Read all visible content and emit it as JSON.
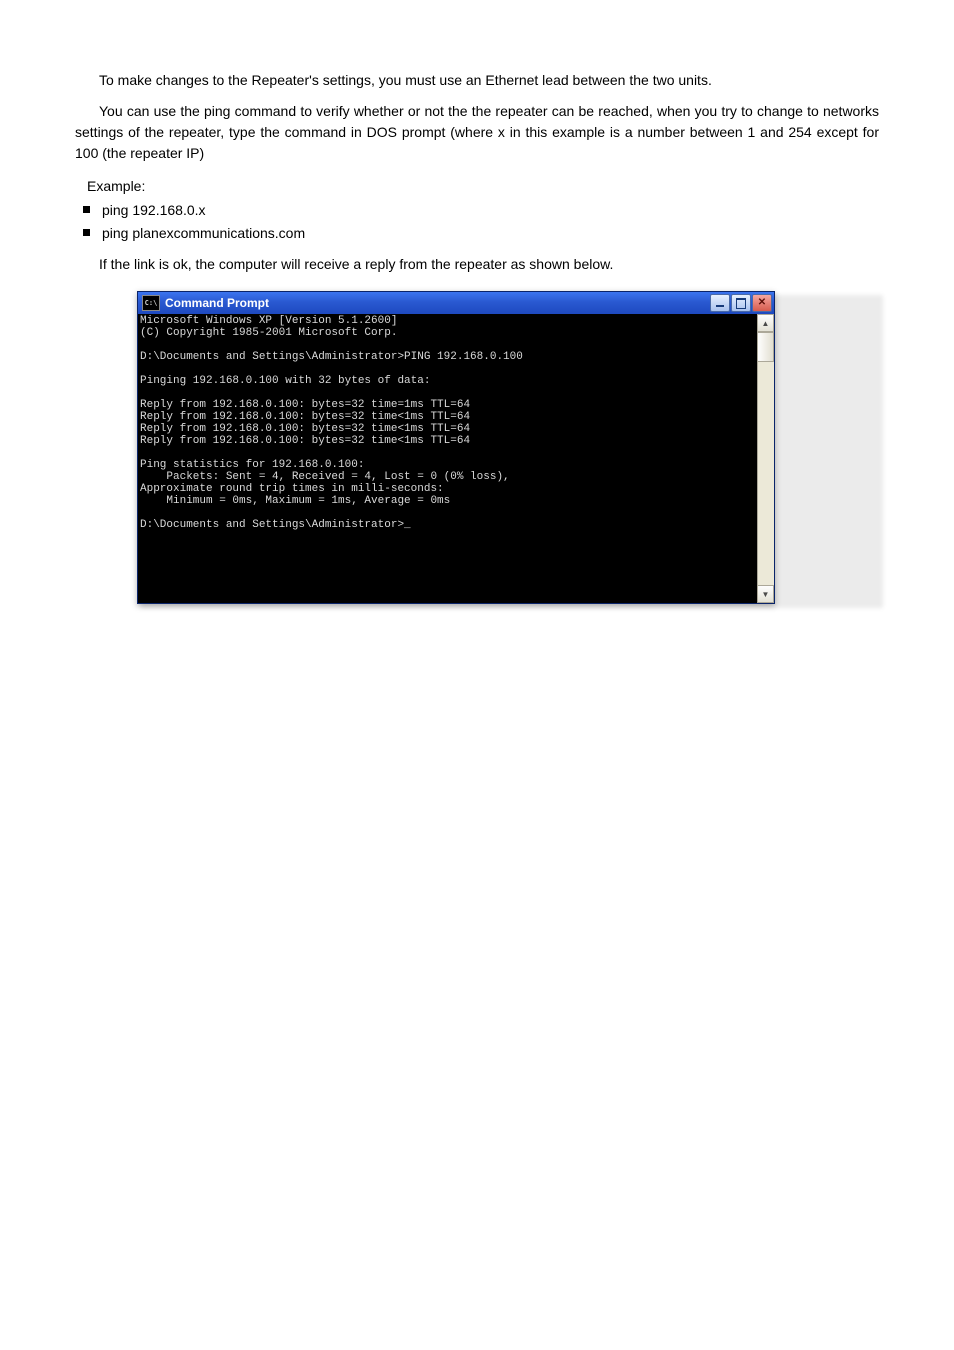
{
  "doc": {
    "para1_before": "To make changes to the Repeater",
    "para1_apostrophe": "'s",
    "para1_after": " settings, you must use an Ethernet lead between the two units.",
    "para2": "You can use the ping command to verify whether or not the the repeater can be reached, when you try to change to networks settings of the repeater, type the command in DOS prompt (where x in this example is a number between 1 and 254 except for 100 (the repeater IP)",
    "label": "Example:",
    "bullet1": "ping 192.168.0.x",
    "bullet2": "ping planexcommunications.com",
    "para3": "If the link is ok, the computer will receive a reply from the repeater as shown below."
  },
  "cmd": {
    "title": "Command Prompt",
    "icon_text": "C:\\",
    "lines": [
      "Microsoft Windows XP [Version 5.1.2600]",
      "(C) Copyright 1985-2001 Microsoft Corp.",
      "",
      "D:\\Documents and Settings\\Administrator>PING 192.168.0.100",
      "",
      "Pinging 192.168.0.100 with 32 bytes of data:",
      "",
      "Reply from 192.168.0.100: bytes=32 time=1ms TTL=64",
      "Reply from 192.168.0.100: bytes=32 time<1ms TTL=64",
      "Reply from 192.168.0.100: bytes=32 time<1ms TTL=64",
      "Reply from 192.168.0.100: bytes=32 time<1ms TTL=64",
      "",
      "Ping statistics for 192.168.0.100:",
      "    Packets: Sent = 4, Received = 4, Lost = 0 (0% loss),",
      "Approximate round trip times in milli-seconds:",
      "    Minimum = 0ms, Maximum = 1ms, Average = 0ms",
      "",
      "D:\\Documents and Settings\\Administrator>_"
    ]
  }
}
